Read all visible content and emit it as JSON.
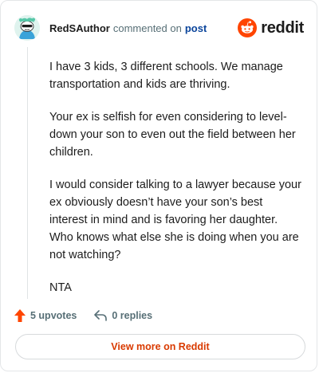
{
  "header": {
    "author": "RedSAuthor",
    "commented_on": "commented on",
    "post_link": "post",
    "brand": "reddit"
  },
  "comment": {
    "paragraphs": [
      "I have 3 kids, 3 different schools. We manage transportation and kids are thriving.",
      "Your ex is selfish for even considering to level-down your son to even out the field between her children.",
      "I would consider talking to a lawyer because your ex obviously doesn’t have your son’s best interest in mind and is favoring her daughter. Who knows what else she is doing when you are not watching?",
      "NTA"
    ]
  },
  "actions": {
    "upvotes": "5 upvotes",
    "replies": "0 replies"
  },
  "footer": {
    "view_more": "View more on Reddit"
  },
  "colors": {
    "brand_orange": "#ff4500",
    "link_blue": "#0a449b",
    "view_more_text": "#d93a00"
  },
  "icons": {
    "avatar": "snoo-avatar-icon",
    "brand": "reddit-snoo-icon",
    "upvote": "upvote-arrow-icon",
    "reply": "reply-arrow-icon"
  }
}
